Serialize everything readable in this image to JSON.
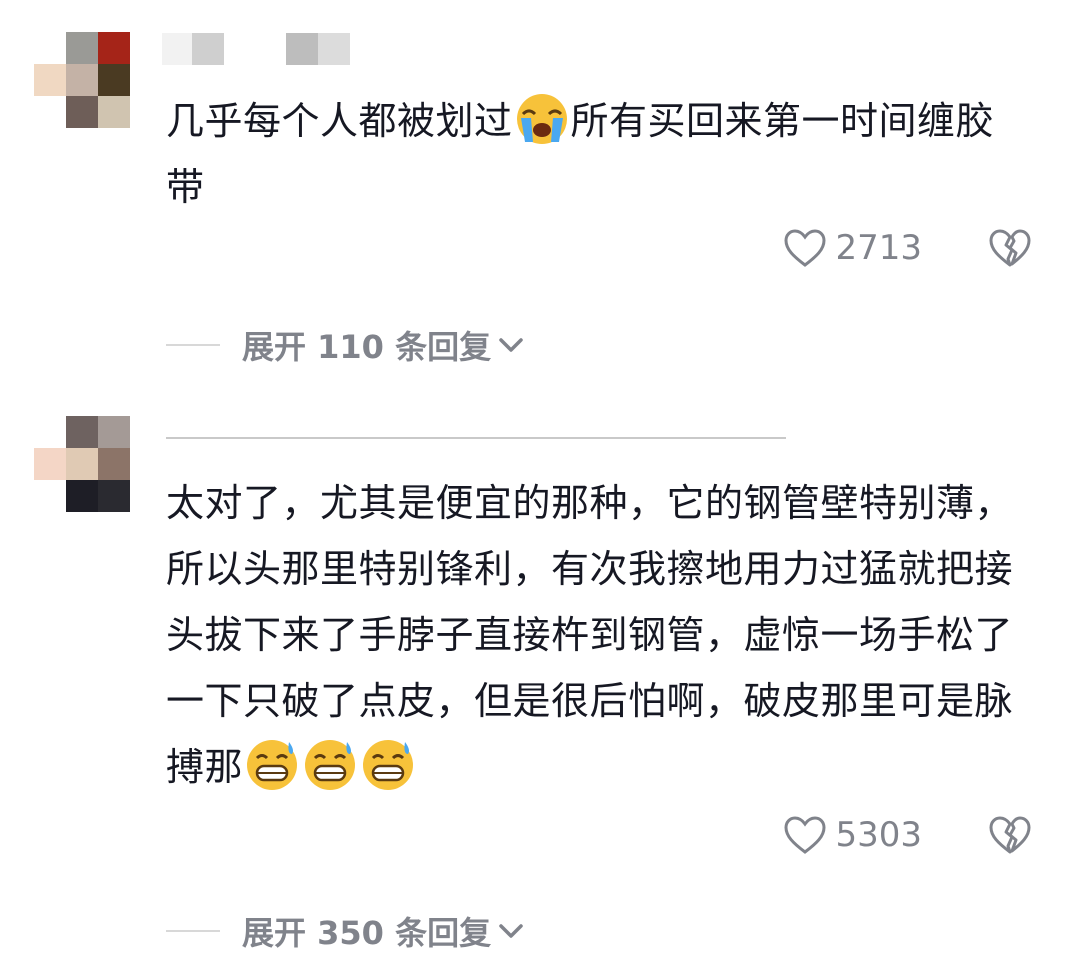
{
  "comments": [
    {
      "text_before_emoji": "几乎每个人都被划过",
      "text_after_emoji": "所有买回来第一时间缠胶带",
      "emoji": "loudly-crying-face",
      "likes": "2713",
      "expand_label": "展开 110 条回复"
    },
    {
      "text": "太对了，尤其是便宜的那种，它的钢管壁特别薄，所以头那里特别锋利，有次我擦地用力过猛就把接头拔下来了手脖子直接杵到钢管，虚惊一场手松了一下只破了点皮，但是很后怕啊，破皮那里可是脉搏那",
      "emoji": "grinning-face-with-sweat",
      "emoji_count": 3,
      "likes": "5303",
      "expand_label": "展开 350 条回复"
    }
  ],
  "icons": {
    "like": "heart-outline-icon",
    "dislike": "broken-heart-icon",
    "expand": "chevron-down-icon"
  },
  "colors": {
    "text": "#161823",
    "meta": "#80838b"
  }
}
